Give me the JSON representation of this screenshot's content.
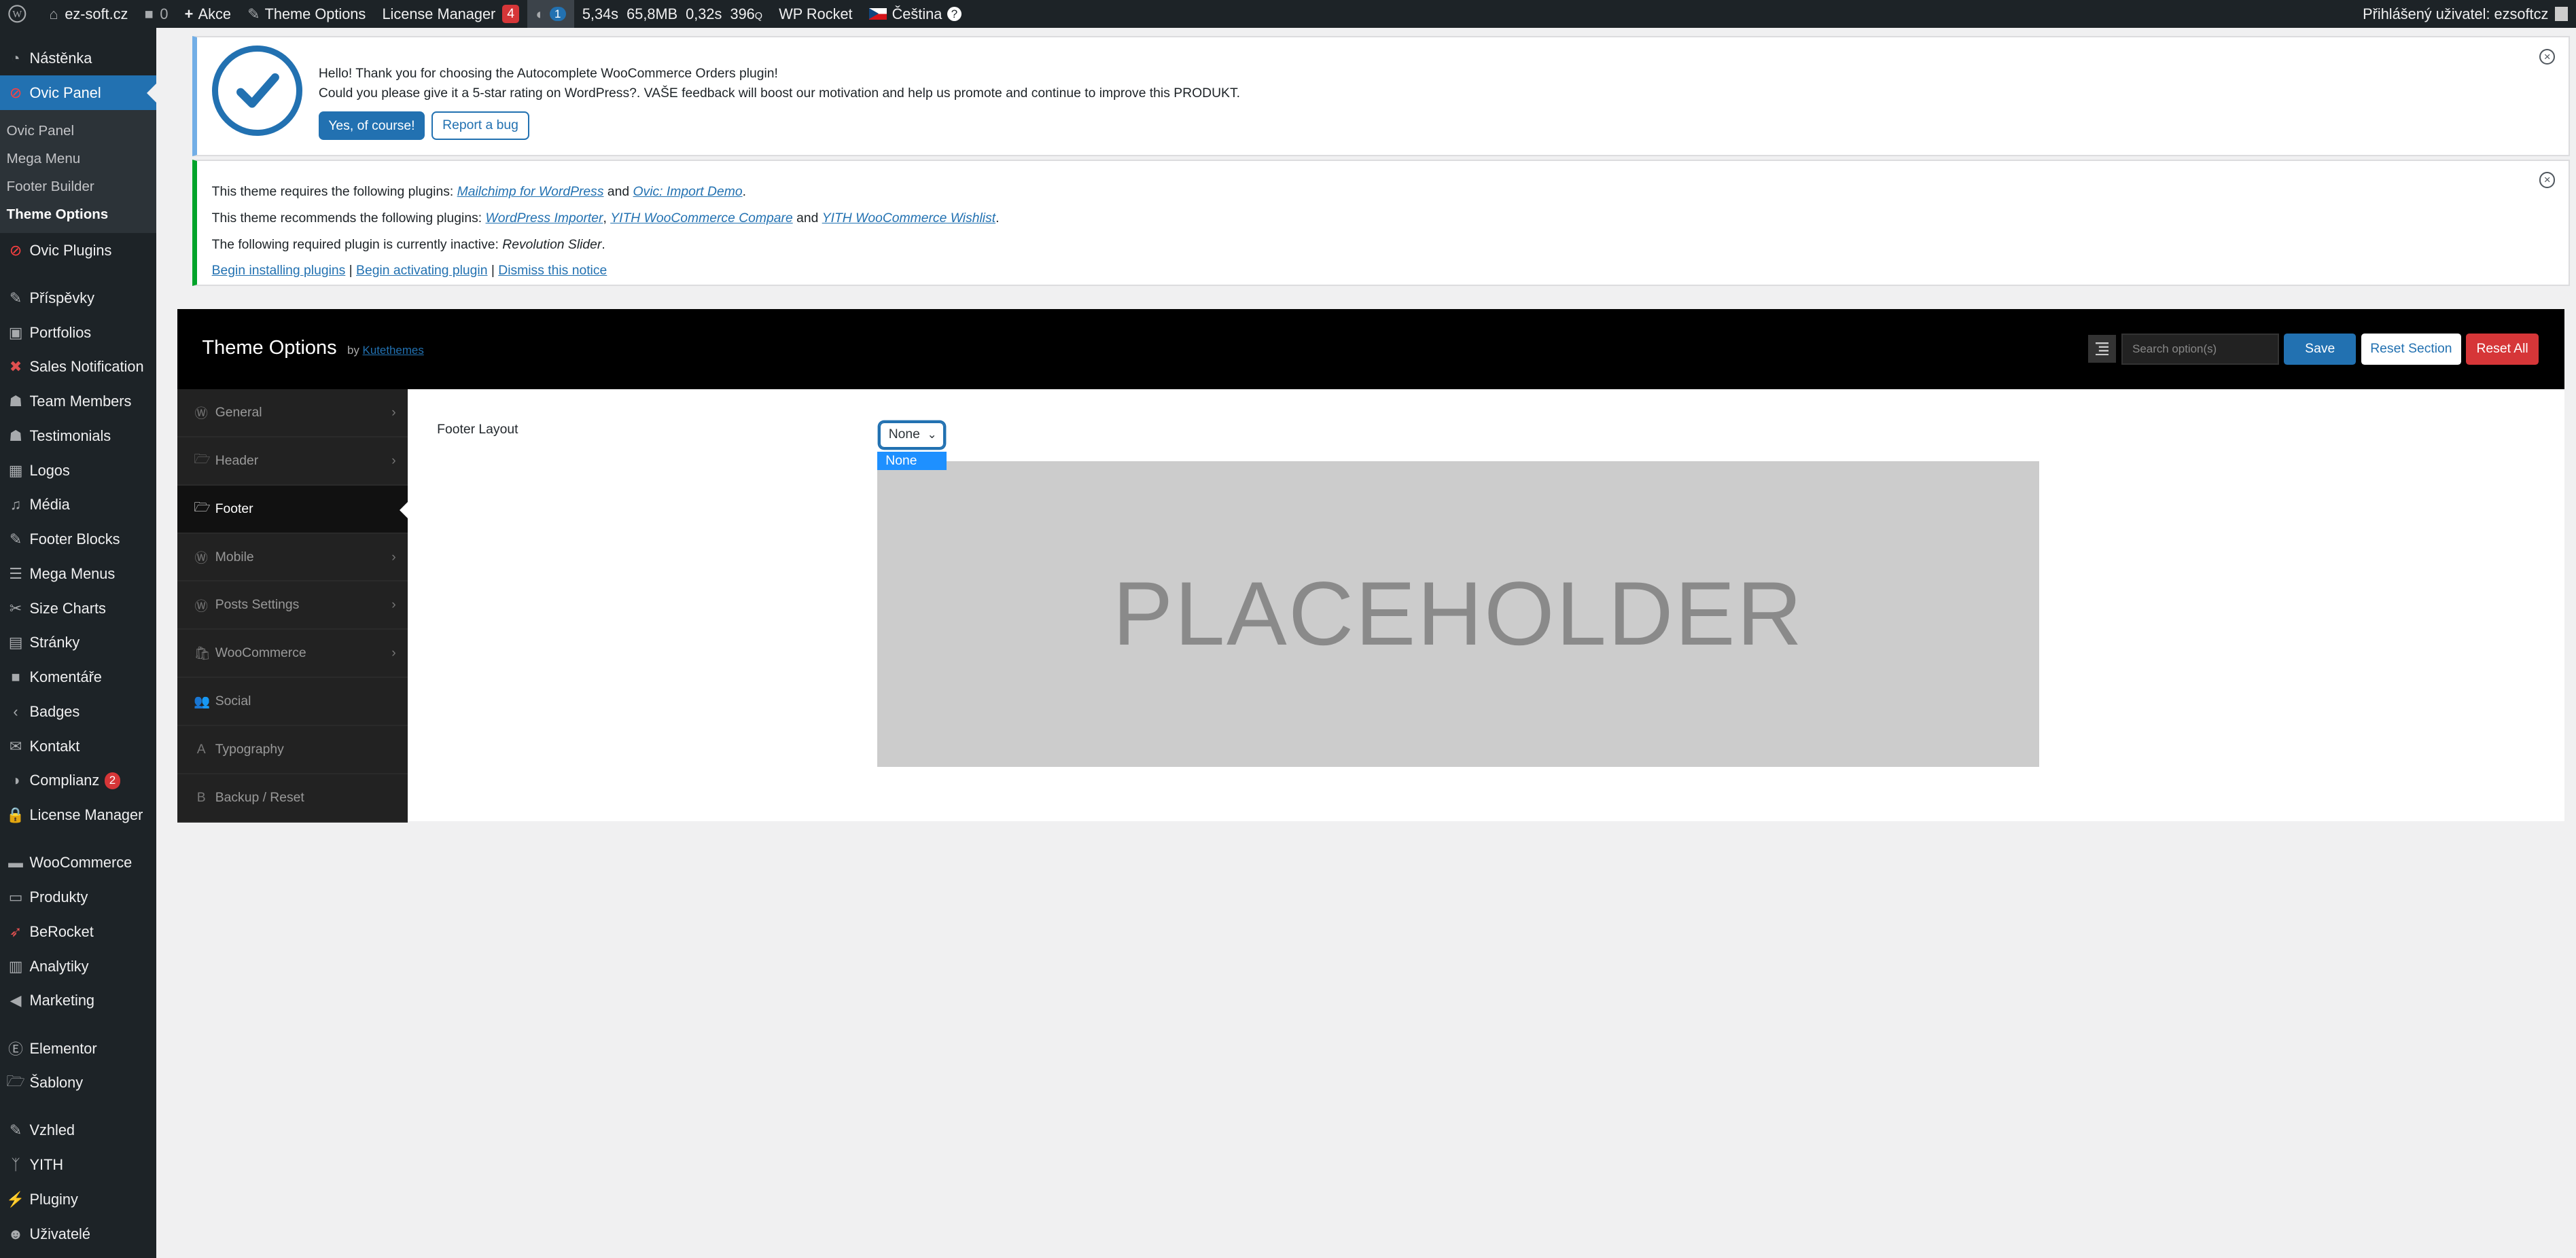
{
  "admin_bar": {
    "site_name": "ez-soft.cz",
    "comments_count": "0",
    "new_label": "Akce",
    "theme_options": "Theme Options",
    "license_manager": "License Manager",
    "license_badge": "4",
    "query_badge": "1",
    "perf_time": "5,34s",
    "perf_mem": "65,8MB",
    "perf_q_time": "0,32s",
    "perf_queries": "396",
    "perf_q_unit": "Q",
    "wp_rocket": "WP Rocket",
    "language": "Čeština",
    "howdy": "Přihlášený uživatel: ezsoftcz"
  },
  "sidebar": {
    "dashboard": "Nástěnka",
    "ovic_panel": "Ovic Panel",
    "submenu": [
      "Ovic Panel",
      "Mega Menu",
      "Footer Builder",
      "Theme Options"
    ],
    "items": [
      "Ovic Plugins",
      "Příspěvky",
      "Portfolios",
      "Sales Notification",
      "Team Members",
      "Testimonials",
      "Logos",
      "Média",
      "Footer Blocks",
      "Mega Menus",
      "Size Charts",
      "Stránky",
      "Komentáře",
      "Badges",
      "Kontakt",
      "Complianz",
      "License Manager",
      "WooCommerce",
      "Produkty",
      "BeRocket",
      "Analytiky",
      "Marketing",
      "Elementor",
      "Šablony",
      "Vzhled",
      "YITH",
      "Pluginy",
      "Uživatelé"
    ],
    "complianz_badge": "2"
  },
  "notice1": {
    "line1": "Hello! Thank you for choosing the Autocomplete WooCommerce Orders plugin!",
    "line2": "Could you please give it a 5-star rating on WordPress?. VAŠE feedback will boost our motivation and help us promote and continue to improve this PRODUKT.",
    "btn_yes": "Yes, of course!",
    "btn_bug": "Report a bug"
  },
  "notice2": {
    "req_prefix": "This theme requires the following plugins: ",
    "req_plugin1": "Mailchimp for WordPress",
    "and1": " and ",
    "req_plugin2": "Ovic: Import Demo",
    "dot": ".",
    "rec_prefix": "This theme recommends the following plugins: ",
    "rec_plugin1": "WordPress Importer",
    "comma": ", ",
    "rec_plugin2": "YITH WooCommerce Compare",
    "and2": " and ",
    "rec_plugin3": "YITH WooCommerce Wishlist",
    "inactive_prefix": "The following required plugin is currently inactive: ",
    "inactive_plugin": "Revolution Slider",
    "link_install": "Begin installing plugins",
    "sep": " | ",
    "link_activate": "Begin activating plugin",
    "link_dismiss": "Dismiss this notice"
  },
  "theme_options": {
    "title": "Theme Options",
    "by": "by",
    "author": "Kutethemes",
    "search_placeholder": "Search option(s)",
    "save": "Save",
    "reset_section": "Reset Section",
    "reset_all": "Reset All",
    "menu": [
      {
        "label": "General",
        "icon": "wordpress-icon",
        "glyph": "Ⓦ"
      },
      {
        "label": "Header",
        "icon": "folder-open-icon",
        "glyph": "🗁"
      },
      {
        "label": "Footer",
        "icon": "folder-open-icon",
        "glyph": "🗁"
      },
      {
        "label": "Mobile",
        "icon": "wordpress-icon",
        "glyph": "Ⓦ"
      },
      {
        "label": "Posts Settings",
        "icon": "wordpress-icon",
        "glyph": "Ⓦ"
      },
      {
        "label": "WooCommerce",
        "icon": "shopping-bag-icon",
        "glyph": "🛍"
      },
      {
        "label": "Social",
        "icon": "users-icon",
        "glyph": "👥"
      },
      {
        "label": "Typography",
        "icon": "font-icon",
        "glyph": "A"
      },
      {
        "label": "Backup / Reset",
        "icon": "bold-icon",
        "glyph": "B"
      }
    ],
    "field_label": "Footer Layout",
    "select_value": "None",
    "option_highlighted": "None",
    "preview_text": "PLACEHOLDER"
  }
}
